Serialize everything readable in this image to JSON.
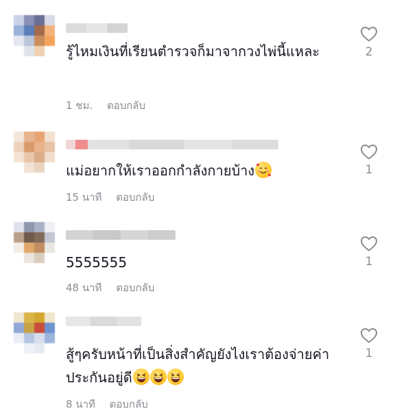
{
  "comments": [
    {
      "username": "",
      "text": "รู้ไหมเงินที่เรียนตำรวจก็มาจากวงไพ่นี้แหละ",
      "time": "1 ชม.",
      "reply": "ตอบกลับ",
      "likes": "2",
      "emoji": []
    },
    {
      "username": "",
      "text": "แม่อยากให้เราออกกำลังกายบ้าง",
      "time": "15 นาที",
      "reply": "ตอบกลับ",
      "likes": "1",
      "emoji": [
        "smiling-face-with-hearts"
      ]
    },
    {
      "username": "",
      "text": "5555555",
      "time": "48 นาที",
      "reply": "ตอบกลับ",
      "likes": "1",
      "emoji": []
    },
    {
      "username": "",
      "text": "สู้ๆครับหน้าที่เป็นสิ่งสำคัญยังไงเราต้องจ่ายค่าประกันอยู่ดี",
      "time": "8 นาที",
      "reply": "ตอบกลับ",
      "likes": "1",
      "emoji": [
        "grinning-squinting-face",
        "grinning-squinting-face",
        "grinning-squinting-face"
      ]
    }
  ],
  "icons": {
    "like": "heart-outline-icon"
  },
  "colors": {
    "text": "#161823",
    "meta": "#8a8b91",
    "heart": "#8a8b91",
    "background": "#ffffff"
  }
}
